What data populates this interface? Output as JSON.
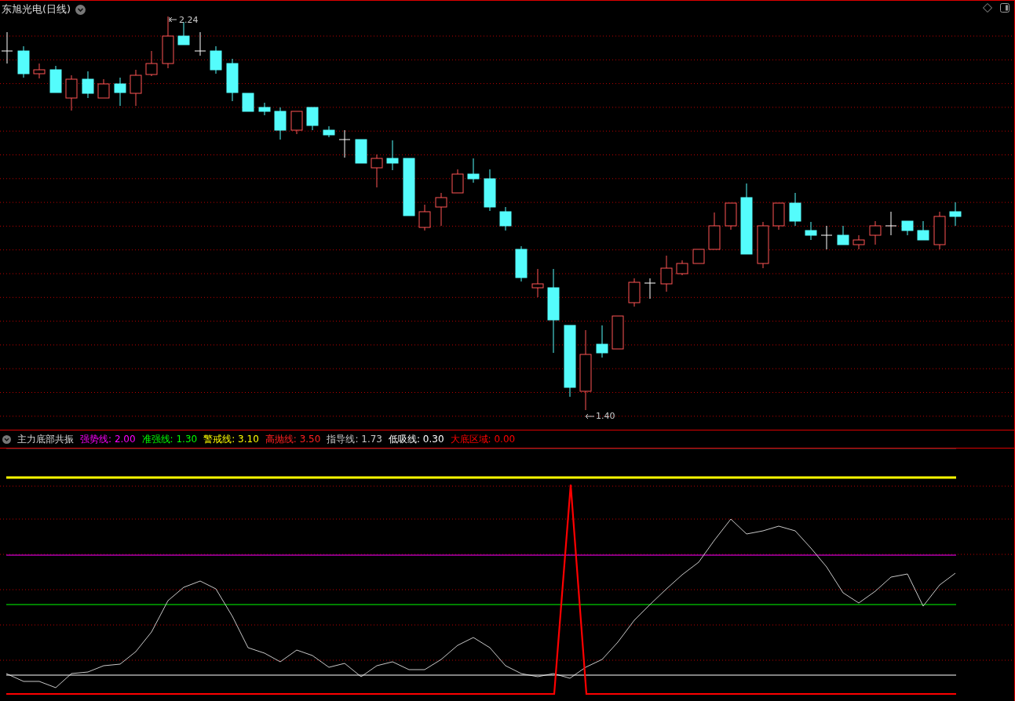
{
  "title": "东旭光电(日线)",
  "high_label": "2.24",
  "low_label": "1.40",
  "indicator": {
    "name": "主力底部共振",
    "lines": [
      {
        "label": "强势线:",
        "value": "2.00",
        "color": "#ff00ff",
        "kind": "hline"
      },
      {
        "label": "准强线:",
        "value": "1.30",
        "color": "#00ff00",
        "kind": "hline"
      },
      {
        "label": "警戒线:",
        "value": "3.10",
        "color": "#ffff00",
        "kind": "hline"
      },
      {
        "label": "高抛线:",
        "value": "3.50",
        "color": "#ff2020",
        "kind": "label"
      },
      {
        "label": "指导线:",
        "value": "1.73",
        "color": "#c8c8c8",
        "kind": "curve"
      },
      {
        "label": "低吸线:",
        "value": "0.30",
        "color": "#ffffff",
        "kind": "hline"
      },
      {
        "label": "大底区域:",
        "value": "0.00",
        "color": "#ff0000",
        "kind": "spike"
      }
    ]
  }
}
